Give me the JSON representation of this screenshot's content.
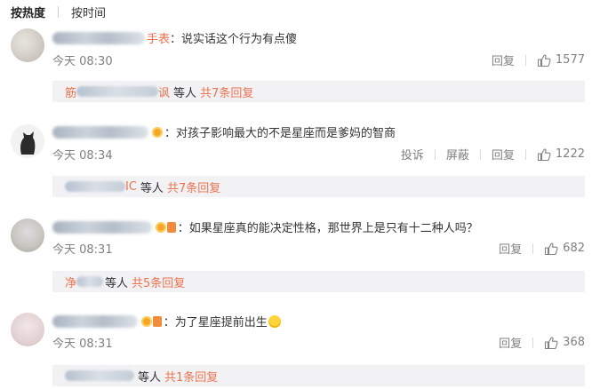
{
  "tabs": [
    {
      "label": "按热度",
      "active": true
    },
    {
      "label": "按时间",
      "active": false
    }
  ],
  "comments": [
    {
      "user_suffix": "手表",
      "text": "：说实话这个行为有点傻",
      "time": "今天 08:30",
      "actions": [
        "回复"
      ],
      "likes": "1577",
      "reply_user": "筋",
      "reply_user_suffix": "讽",
      "reply_tail": "等人",
      "reply_count": "共7条回复"
    },
    {
      "user_suffix": "",
      "text": "：对孩子影响最大的不是星座而是爹妈的智商",
      "time": "今天 08:34",
      "actions": [
        "投诉",
        "屏蔽",
        "回复"
      ],
      "likes": "1222",
      "reply_user": "",
      "reply_user_suffix": "IC",
      "reply_tail": "等人",
      "reply_count": "共7条回复"
    },
    {
      "user_suffix": "",
      "text": "：如果星座真的能决定性格，那世界上是只有十二种人吗？",
      "time": "今天 08:31",
      "actions": [
        "回复"
      ],
      "likes": "682",
      "reply_user": "净",
      "reply_user_suffix": "",
      "reply_tail": "等人",
      "reply_count": "共5条回复"
    },
    {
      "user_suffix": "",
      "text": "：为了星座提前出生",
      "time": "今天 08:31",
      "actions": [
        "回复"
      ],
      "likes": "368",
      "reply_user": "",
      "reply_user_suffix": "",
      "reply_tail": "等人",
      "reply_count": "共1条回复"
    }
  ],
  "colors": {
    "link_orange": "#eb7350",
    "muted_gray": "#808080",
    "reply_bg": "#f2f2f5"
  }
}
